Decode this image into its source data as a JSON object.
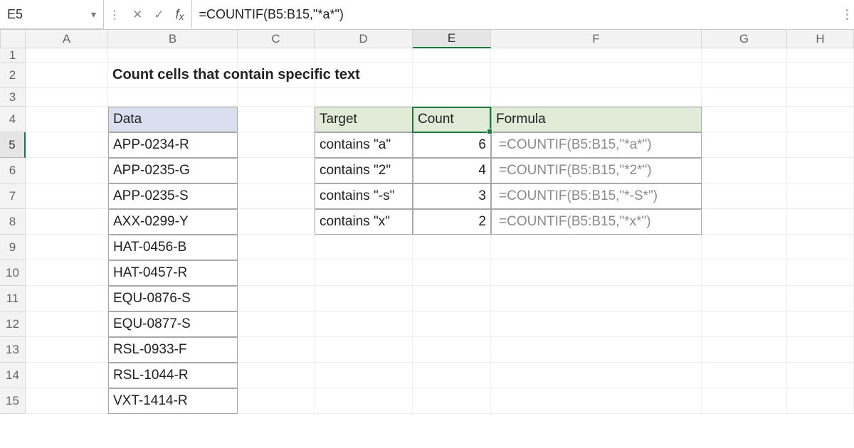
{
  "formula_bar": {
    "name_box": "E5",
    "formula": "=COUNTIF(B5:B15,\"*a*\")"
  },
  "columns": [
    "A",
    "B",
    "C",
    "D",
    "E",
    "F",
    "G",
    "H"
  ],
  "rows": [
    "1",
    "2",
    "3",
    "4",
    "5",
    "6",
    "7",
    "8",
    "9",
    "10",
    "11",
    "12",
    "13",
    "14",
    "15"
  ],
  "title": "Count cells that contain specific text",
  "data_header": "Data",
  "data_values": [
    "APP-0234-R",
    "APP-0235-G",
    "APP-0235-S",
    "AXX-0299-Y",
    "HAT-0456-B",
    "HAT-0457-R",
    "EQU-0876-S",
    "EQU-0877-S",
    "RSL-0933-F",
    "RSL-1044-R",
    "VXT-1414-R"
  ],
  "result_headers": {
    "target": "Target",
    "count": "Count",
    "formula": "Formula"
  },
  "results": [
    {
      "target": "contains \"a\"",
      "count": "6",
      "formula": "=COUNTIF(B5:B15,\"*a*\")"
    },
    {
      "target": "contains \"2\"",
      "count": "4",
      "formula": "=COUNTIF(B5:B15,\"*2*\")"
    },
    {
      "target": "contains \"-s\"",
      "count": "3",
      "formula": "=COUNTIF(B5:B15,\"*-S*\")"
    },
    {
      "target": "contains \"x\"",
      "count": "2",
      "formula": "=COUNTIF(B5:B15,\"*x*\")"
    }
  ],
  "active_cell": "E5",
  "chart_data": {
    "type": "table",
    "title": "Count cells that contain specific text",
    "columns": [
      "Target",
      "Count",
      "Formula"
    ],
    "rows": [
      [
        "contains \"a\"",
        6,
        "=COUNTIF(B5:B15,\"*a*\")"
      ],
      [
        "contains \"2\"",
        4,
        "=COUNTIF(B5:B15,\"*2*\")"
      ],
      [
        "contains \"-s\"",
        3,
        "=COUNTIF(B5:B15,\"*-S*\")"
      ],
      [
        "contains \"x\"",
        2,
        "=COUNTIF(B5:B15,\"*x*\")"
      ]
    ]
  }
}
